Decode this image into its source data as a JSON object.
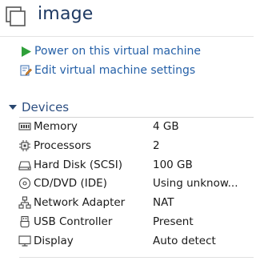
{
  "vm": {
    "title": "image"
  },
  "actions": {
    "power_on": "Power on this virtual machine",
    "edit_settings": "Edit virtual machine settings"
  },
  "devices": {
    "header": "Devices",
    "items": [
      {
        "name": "Memory",
        "value": "4 GB",
        "icon": "memory-icon"
      },
      {
        "name": "Processors",
        "value": "2",
        "icon": "processor-icon"
      },
      {
        "name": "Hard Disk (SCSI)",
        "value": "100 GB",
        "icon": "hard-disk-icon"
      },
      {
        "name": "CD/DVD (IDE)",
        "value": "Using unknow...",
        "icon": "cd-dvd-icon"
      },
      {
        "name": "Network Adapter",
        "value": "NAT",
        "icon": "network-adapter-icon"
      },
      {
        "name": "USB Controller",
        "value": "Present",
        "icon": "usb-controller-icon"
      },
      {
        "name": "Display",
        "value": "Auto detect",
        "icon": "display-icon"
      }
    ]
  },
  "colors": {
    "title": "#1f3a63",
    "link": "#2661a8",
    "play": "#2fa03a",
    "section": "#2d4f82"
  }
}
